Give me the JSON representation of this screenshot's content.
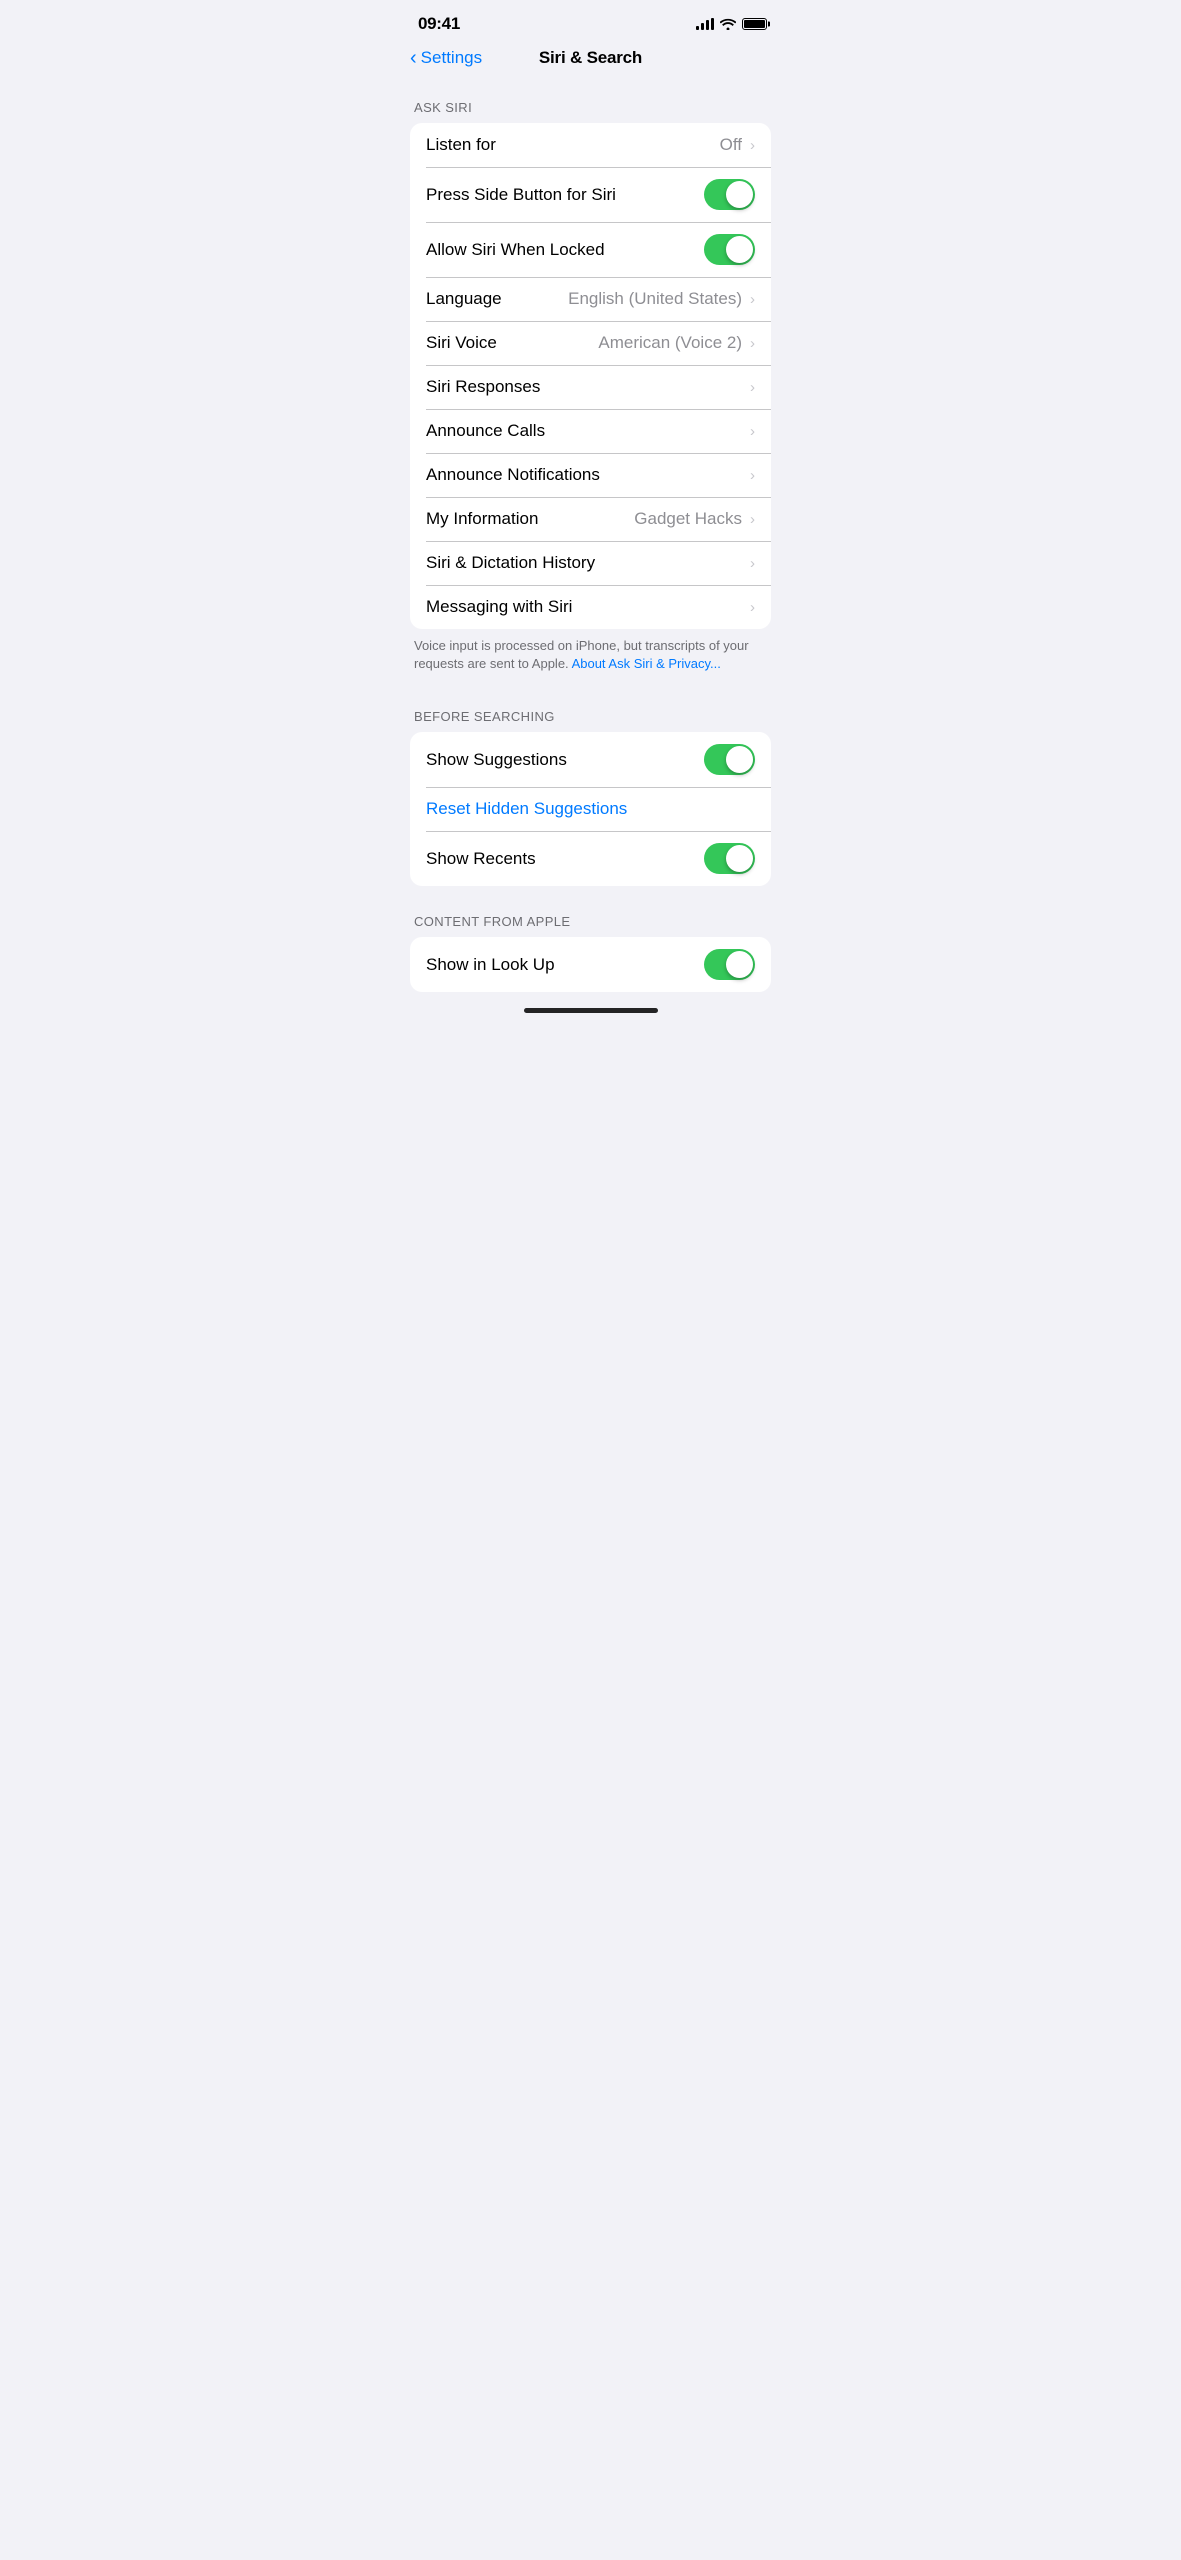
{
  "statusBar": {
    "time": "09:41",
    "battery": 100
  },
  "nav": {
    "backLabel": "Settings",
    "title": "Siri & Search"
  },
  "sections": {
    "askSiri": {
      "label": "ASK SIRI",
      "rows": [
        {
          "id": "listen-for",
          "label": "Listen for",
          "value": "Off",
          "type": "chevron",
          "toggleState": null
        },
        {
          "id": "press-side",
          "label": "Press Side Button for Siri",
          "value": null,
          "type": "toggle",
          "toggleState": "on"
        },
        {
          "id": "allow-locked",
          "label": "Allow Siri When Locked",
          "value": null,
          "type": "toggle",
          "toggleState": "on"
        },
        {
          "id": "language",
          "label": "Language",
          "value": "English (United States)",
          "type": "chevron",
          "toggleState": null
        },
        {
          "id": "siri-voice",
          "label": "Siri Voice",
          "value": "American (Voice 2)",
          "type": "chevron",
          "toggleState": null
        },
        {
          "id": "siri-responses",
          "label": "Siri Responses",
          "value": null,
          "type": "chevron",
          "toggleState": null
        },
        {
          "id": "announce-calls",
          "label": "Announce Calls",
          "value": null,
          "type": "chevron",
          "toggleState": null
        },
        {
          "id": "announce-notifications",
          "label": "Announce Notifications",
          "value": null,
          "type": "chevron",
          "toggleState": null
        },
        {
          "id": "my-information",
          "label": "My Information",
          "value": "Gadget Hacks",
          "type": "chevron",
          "toggleState": null
        },
        {
          "id": "siri-dictation",
          "label": "Siri & Dictation History",
          "value": null,
          "type": "chevron",
          "toggleState": null
        },
        {
          "id": "messaging",
          "label": "Messaging with Siri",
          "value": null,
          "type": "chevron",
          "toggleState": null
        }
      ],
      "footerText": "Voice input is processed on iPhone, but transcripts of your requests are sent to Apple.",
      "footerLinkText": "About Ask Siri & Privacy..."
    },
    "beforeSearching": {
      "label": "BEFORE SEARCHING",
      "rows": [
        {
          "id": "show-suggestions",
          "label": "Show Suggestions",
          "value": null,
          "type": "toggle",
          "toggleState": "on"
        },
        {
          "id": "reset-hidden",
          "label": "Reset Hidden Suggestions",
          "value": null,
          "type": "link",
          "toggleState": null
        },
        {
          "id": "show-recents",
          "label": "Show Recents",
          "value": null,
          "type": "toggle",
          "toggleState": "on"
        }
      ]
    },
    "contentFromApple": {
      "label": "CONTENT FROM APPLE",
      "rows": [
        {
          "id": "show-look-up",
          "label": "Show in Look Up",
          "value": null,
          "type": "toggle",
          "toggleState": "on"
        }
      ]
    }
  }
}
